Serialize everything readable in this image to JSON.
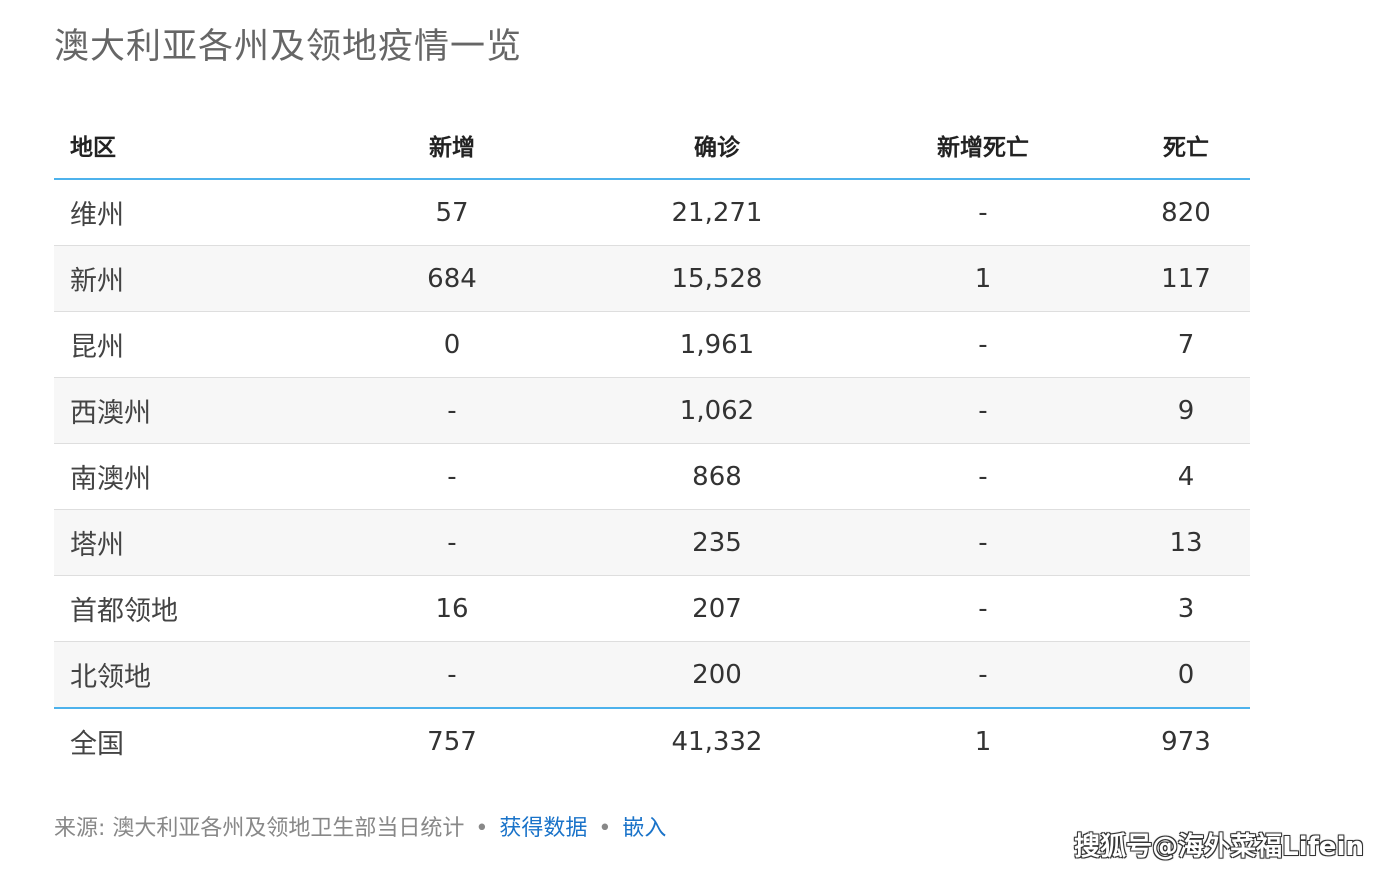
{
  "title": "澳大利亚各州及领地疫情一览",
  "table": {
    "headers": [
      "地区",
      "新增",
      "确诊",
      "新增死亡",
      "死亡"
    ],
    "rows": [
      {
        "region": "维州",
        "new": "57",
        "confirmed": "21,271",
        "new_deaths": "-",
        "deaths": "820"
      },
      {
        "region": "新州",
        "new": "684",
        "confirmed": "15,528",
        "new_deaths": "1",
        "deaths": "117"
      },
      {
        "region": "昆州",
        "new": "0",
        "confirmed": "1,961",
        "new_deaths": "-",
        "deaths": "7"
      },
      {
        "region": "西澳州",
        "new": "-",
        "confirmed": "1,062",
        "new_deaths": "-",
        "deaths": "9"
      },
      {
        "region": "南澳州",
        "new": "-",
        "confirmed": "868",
        "new_deaths": "-",
        "deaths": "4"
      },
      {
        "region": "塔州",
        "new": "-",
        "confirmed": "235",
        "new_deaths": "-",
        "deaths": "13"
      },
      {
        "region": "首都领地",
        "new": "16",
        "confirmed": "207",
        "new_deaths": "-",
        "deaths": "3"
      },
      {
        "region": "北领地",
        "new": "-",
        "confirmed": "200",
        "new_deaths": "-",
        "deaths": "0"
      }
    ],
    "total": {
      "region": "全国",
      "new": "757",
      "confirmed": "41,332",
      "new_deaths": "1",
      "deaths": "973"
    }
  },
  "footer": {
    "source": "来源: 澳大利亚各州及领地卫生部当日统计",
    "separator": "•",
    "get_data": "获得数据",
    "embed": "嵌入"
  },
  "watermark": "搜狐号@海外菜福Lifein",
  "colors": {
    "accent_line": "#4db2ec",
    "link": "#1a73c9",
    "alt_row": "#f7f7f7"
  }
}
